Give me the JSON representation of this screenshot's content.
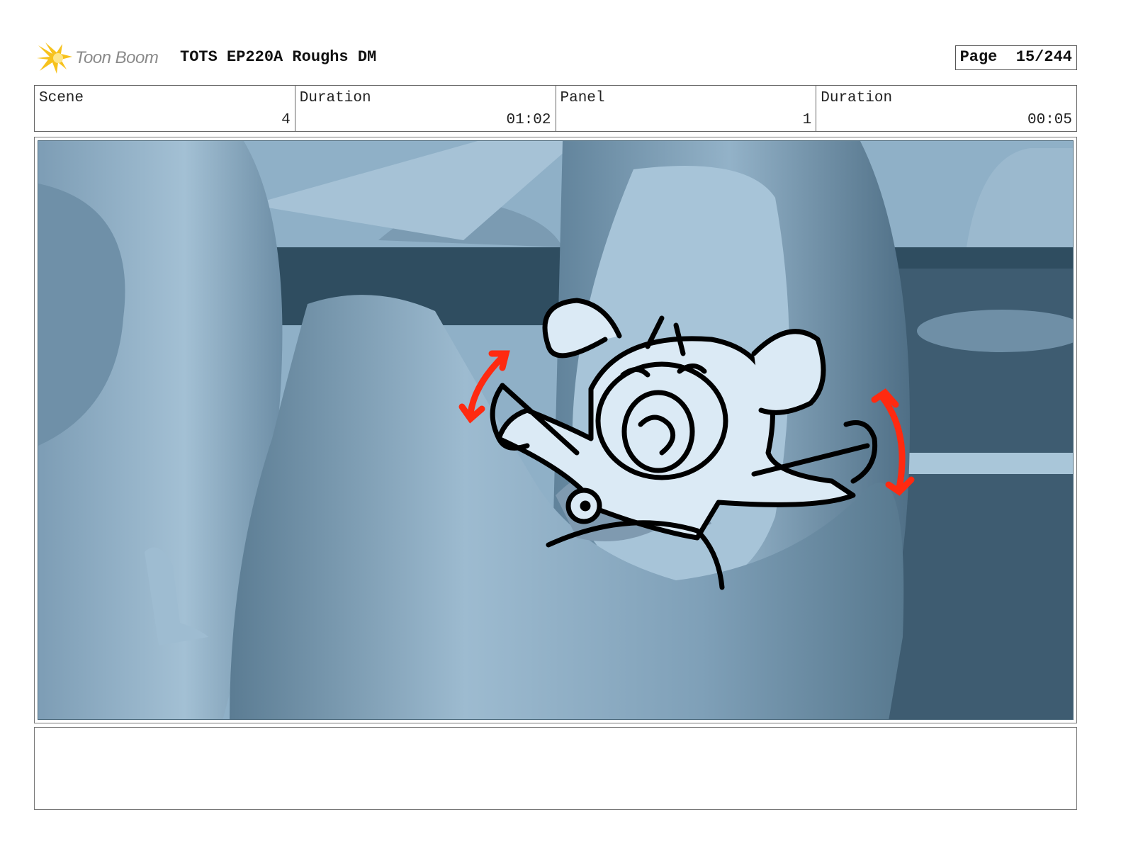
{
  "header": {
    "logo_text": "Toon Boom",
    "title": "TOTS EP220A Roughs DM",
    "page_label": "Page",
    "page_value": "15/244"
  },
  "info": [
    {
      "label": "Scene",
      "value": "4"
    },
    {
      "label": "Duration",
      "value": "01:02"
    },
    {
      "label": "Panel",
      "value": "1"
    },
    {
      "label": "Duration",
      "value": "00:05"
    }
  ],
  "panel": {
    "description": "",
    "colors": {
      "background_dark": "#2f4d60",
      "background_mid": "#6f93ab",
      "background_light": "#9fbdd2",
      "character_fill": "#dbeaf5",
      "sketch_line": "#000000",
      "arrow_red": "#ff2a10"
    }
  },
  "notes": {
    "text": ""
  }
}
